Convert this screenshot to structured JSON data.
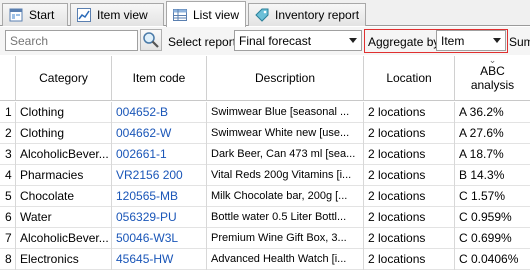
{
  "tabs": [
    {
      "label": "Start",
      "icon": "start-page-icon"
    },
    {
      "label": "Item view",
      "icon": "chart-icon"
    },
    {
      "label": "List view",
      "icon": "list-table-icon"
    },
    {
      "label": "Inventory report",
      "icon": "tag-icon"
    }
  ],
  "toolbar": {
    "search_placeholder": "Search",
    "select_report_label": "Select report",
    "report_value": "Final forecast",
    "aggregate_label": "Aggregate by",
    "aggregate_value": "Item",
    "sum_label": "Sum"
  },
  "columns": {
    "category": "Category",
    "item_code": "Item code",
    "description": "Description",
    "location": "Location",
    "abc": "ABC analysis"
  },
  "rows": [
    {
      "n": "1",
      "category": "Clothing",
      "code": "004652-B",
      "desc": "Swimwear Blue [seasonal ...",
      "loc": "2 locations",
      "abc": "A 36.2%"
    },
    {
      "n": "2",
      "category": "Clothing",
      "code": "004662-W",
      "desc": "Swimwear White new [use...",
      "loc": "2 locations",
      "abc": "A 27.6%"
    },
    {
      "n": "3",
      "category": "AlcoholicBever...",
      "code": "002661-1",
      "desc": "Dark Beer, Can 473 ml [sea...",
      "loc": "2 locations",
      "abc": "A 18.7%"
    },
    {
      "n": "4",
      "category": "Pharmacies",
      "code": "VR2156 200",
      "desc": "Vital Reds 200g Vitamins [i...",
      "loc": "2 locations",
      "abc": "B 14.3%"
    },
    {
      "n": "5",
      "category": "Chocolate",
      "code": "120565-MB",
      "desc": "Milk Chocolate bar, 200g [...",
      "loc": "2 locations",
      "abc": "C 1.57%"
    },
    {
      "n": "6",
      "category": "Water",
      "code": "056329-PU",
      "desc": "Bottle water 0.5 Liter Bottl...",
      "loc": "2 locations",
      "abc": "C 0.959%"
    },
    {
      "n": "7",
      "category": "AlcoholicBever...",
      "code": "50046-W3L",
      "desc": "Premium Wine Gift Box, 3...",
      "loc": "2 locations",
      "abc": "C 0.699%"
    },
    {
      "n": "8",
      "category": "Electronics",
      "code": "45645-HW",
      "desc": "Advanced Health Watch [i...",
      "loc": "2 locations",
      "abc": "C 0.0406%"
    }
  ],
  "colors": {
    "link": "#1a56b8",
    "highlight_border": "#e03030"
  }
}
